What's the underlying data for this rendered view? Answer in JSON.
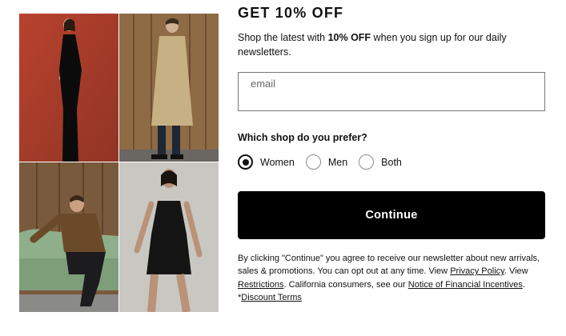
{
  "promo": {
    "headline": "GET 10% OFF",
    "subtitle_before": "Shop the latest with ",
    "subtitle_bold": "10% OFF",
    "subtitle_after": " when you sign up for our daily newsletters."
  },
  "email": {
    "placeholder": "email",
    "value": ""
  },
  "preference": {
    "question": "Which shop do you prefer?",
    "options": [
      {
        "label": "Women",
        "selected": true
      },
      {
        "label": "Men",
        "selected": false
      },
      {
        "label": "Both",
        "selected": false
      }
    ]
  },
  "cta": {
    "label": "Continue"
  },
  "legal": {
    "text1": "By clicking \"Continue\" you agree to receive our newsletter about new arrivals, sales & promotions. You can opt out at any time. View ",
    "privacy_link": "Privacy Policy",
    "text2": ". View ",
    "restrictions_link": "Restrictions",
    "text3": ". California consumers, see our ",
    "incentives_link": "Notice of Financial Incentives",
    "text4": ".",
    "asterisk": "*",
    "discount_link": "Discount Terms"
  },
  "colors": {
    "tile1_bg": "#b8422e",
    "tile2_bg": "#8e6a45",
    "tile3_bg": "#7a5a3c",
    "tile4_bg": "#c9c7c2",
    "button_bg": "#000000"
  }
}
